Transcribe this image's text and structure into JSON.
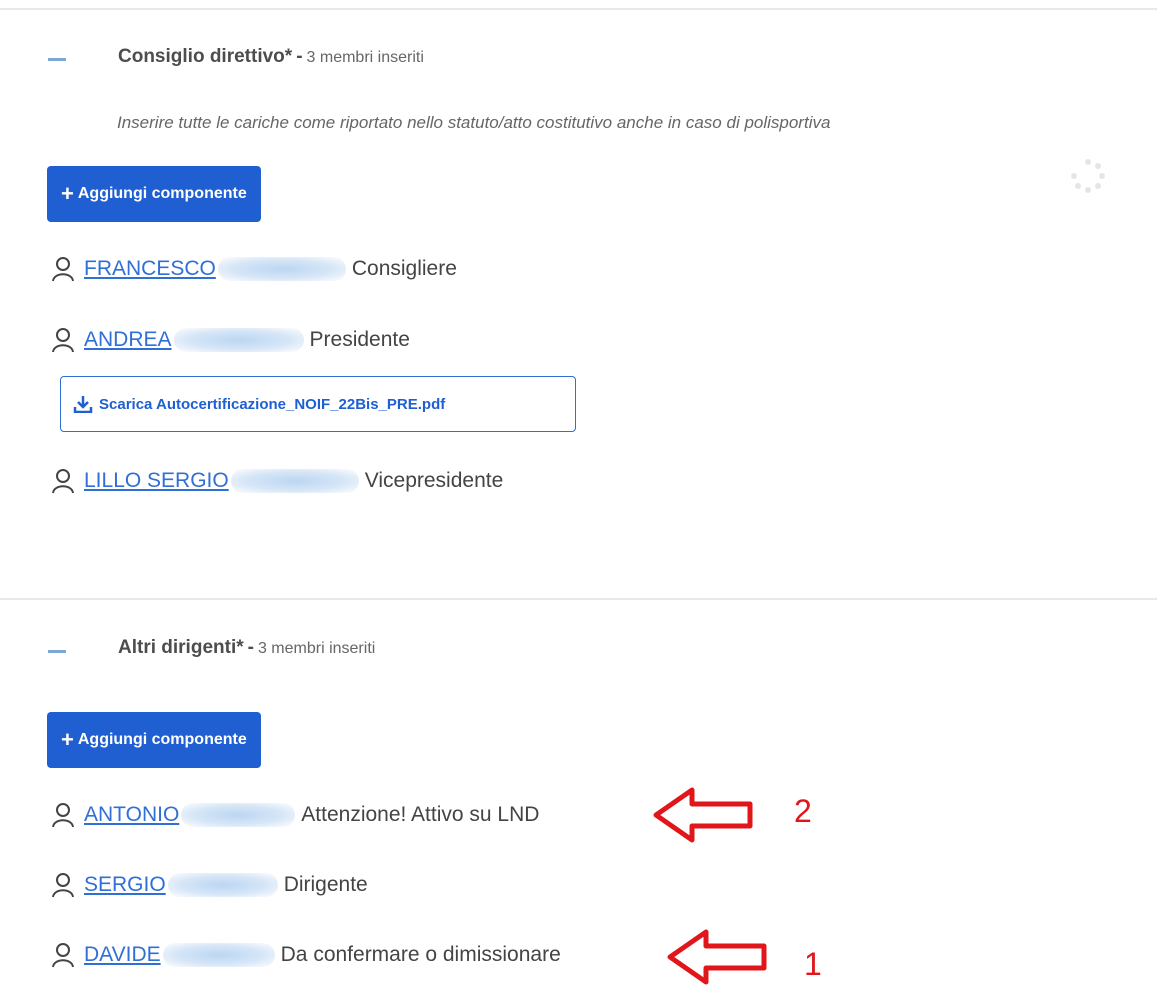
{
  "sections": [
    {
      "title": "Consiglio direttivo*",
      "separator": "-",
      "count": "3 membri inseriti",
      "note": "Inserire tutte le cariche come riportato nello statuto/atto costitutivo anche in caso di polisportiva",
      "add_button": "Aggiungi componente",
      "members": [
        {
          "name": "FRANCESCO",
          "role": "Consigliere"
        },
        {
          "name": "ANDREA",
          "role": "Presidente"
        },
        {
          "name": "LILLO SERGIO",
          "role": "Vicepresidente"
        }
      ],
      "download_button": "Scarica Autocertificazione_NOIF_22Bis_PRE.pdf"
    },
    {
      "title": "Altri dirigenti*",
      "separator": "-",
      "count": "3 membri inseriti",
      "add_button": "Aggiungi componente",
      "members": [
        {
          "name": "ANTONIO",
          "role": "Attenzione! Attivo su LND"
        },
        {
          "name": "SERGIO",
          "role": "Dirigente"
        },
        {
          "name": "DAVIDE",
          "role": "Da confermare o dimissionare"
        }
      ]
    }
  ],
  "annotations": [
    "2",
    "1"
  ],
  "colors": {
    "primary": "#1f5fd1",
    "link": "#2f6fd6",
    "annotation": "#e0161a",
    "divider": "#e8e8e8"
  },
  "icons": {
    "member": "user-icon",
    "add": "plus-icon",
    "download": "download-icon",
    "collapse": "minus-icon"
  }
}
